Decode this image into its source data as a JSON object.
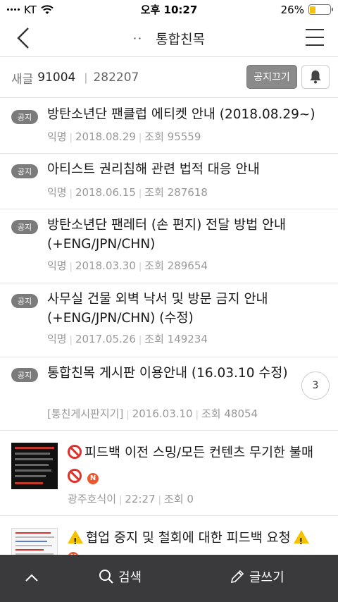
{
  "status_bar": {
    "carrier": "KT",
    "time": "오후 10:27",
    "battery_percent": "26%",
    "battery_level": 0.26
  },
  "nav": {
    "dots": "··",
    "title": "통합친목"
  },
  "info": {
    "posts_label": "새글",
    "posts_count": "91004",
    "members_count": "282207",
    "notice_toggle_label": "공지끄기"
  },
  "posts": [
    {
      "badge": "공지",
      "title": "방탄소년단 팬클럽 에티켓 안내 (2018.08.29~)",
      "author": "익명",
      "date": "2018.08.29",
      "views": "조회 95559"
    },
    {
      "badge": "공지",
      "title": "아티스트 권리침해 관련 법적 대응 안내",
      "author": "익명",
      "date": "2018.06.15",
      "views": "조회 287618"
    },
    {
      "badge": "공지",
      "title": "방탄소년단 팬레터 (손 편지) 전달 방법 안내 (+ENG/JPN/CHN)",
      "author": "익명",
      "date": "2018.03.30",
      "views": "조회 289654"
    },
    {
      "badge": "공지",
      "title": "사무실 건물 외벽 낙서 및 방문 금지 안내 (+ENG/JPN/CHN) (수정)",
      "author": "익명",
      "date": "2017.05.26",
      "views": "조회 149234"
    },
    {
      "badge": "공지",
      "title": "통합친목 게시판 이용안내 (16.03.10 수정)",
      "author": "[통친게시판지기]",
      "date": "2016.03.10",
      "views": "조회 48054",
      "comments": "3"
    },
    {
      "title": "피드백 이전 스밍/모든 컨텐츠 무기한 불매",
      "author": "광주호식이",
      "date": "22:27",
      "views": "조회 0",
      "new_label": "N"
    },
    {
      "title": "협업 중지 및 철회에 대한 피드백 요청",
      "new_label": "N"
    }
  ],
  "bottom_bar": {
    "search_label": "검색",
    "write_label": "글쓰기"
  }
}
